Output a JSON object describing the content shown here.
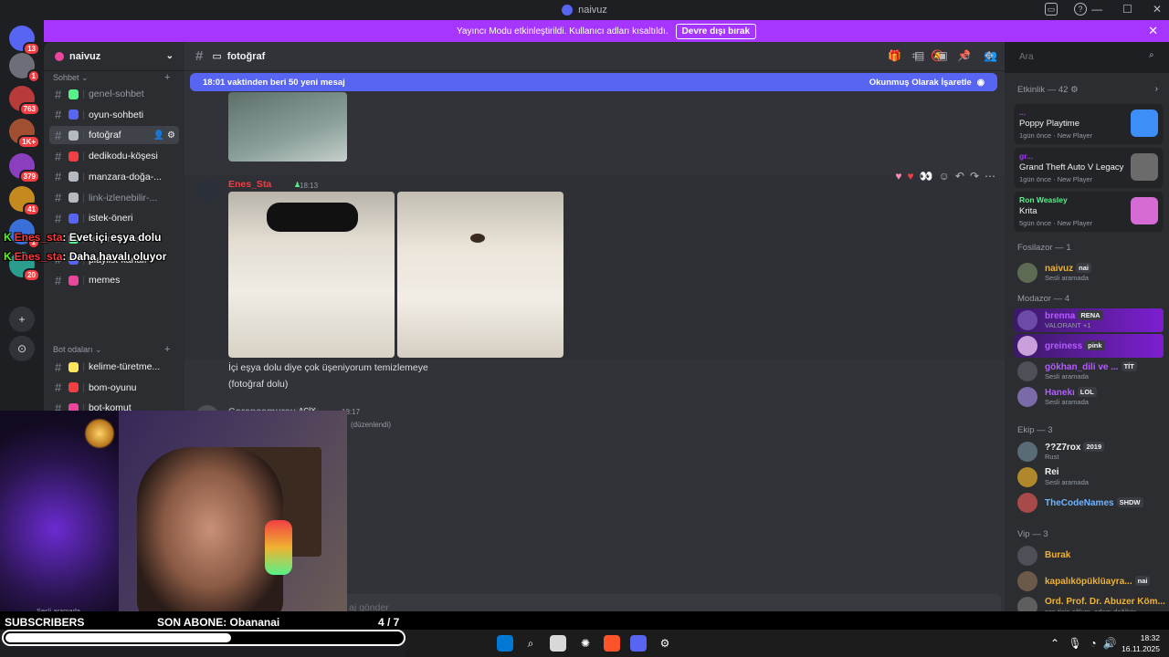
{
  "window": {
    "title": "naivuz",
    "controls": [
      "—",
      "☐",
      "✕"
    ]
  },
  "servers": [
    {
      "badge": "13",
      "color": "#5865f2"
    },
    {
      "badge": "1",
      "color": "#6d6f78"
    },
    {
      "badge": "763",
      "color": "#b83a3a"
    },
    {
      "badge": "1K+",
      "color": "#a05030"
    },
    {
      "badge": "379",
      "color": "#8a3fbf"
    },
    {
      "badge": "41",
      "color": "#c48a1f"
    },
    {
      "badge": "1",
      "color": "#3a6fd8"
    },
    {
      "badge": "20",
      "color": "#2a9d8f"
    }
  ],
  "banner": {
    "text": "Yayıncı Modu etkinleştirildi. Kullanıcı adları kısaltıldı.",
    "button": "Devre dışı bırak",
    "close": "✕"
  },
  "guild": {
    "name": "naivuz"
  },
  "categories": {
    "sohbet": "Sohbet",
    "bot": "Bot odaları"
  },
  "channels": [
    {
      "name": "genel-sohbet",
      "color": "#57f287",
      "state": ""
    },
    {
      "name": "oyun-sohbeti",
      "color": "#5865f2",
      "state": "unread"
    },
    {
      "name": "fotoğraf",
      "color": "#b5bac1",
      "state": "active"
    },
    {
      "name": "dedikodu-köşesi",
      "color": "#f23f43",
      "state": "unread",
      "prefix": "⁉"
    },
    {
      "name": "manzara-doğa-...",
      "color": "#b5bac1",
      "state": "unread"
    },
    {
      "name": "link-izlenebilir-...",
      "color": "#b5bac1",
      "state": ""
    },
    {
      "name": "istek-öneri",
      "color": "#5865f2",
      "state": "unread"
    },
    {
      "name": "resim-ve-tasarım",
      "color": "#57f287",
      "state": ""
    },
    {
      "name": "playlist-kanalı",
      "color": "#5865f2",
      "state": "unread"
    },
    {
      "name": "memes",
      "color": "#eb459e",
      "state": "unread"
    }
  ],
  "bot_channels": [
    {
      "name": "kelime-türetme...",
      "color": "#fee75c"
    },
    {
      "name": "bom-oyunu",
      "color": "#f23f43"
    },
    {
      "name": "bot-komut",
      "color": "#eb459e"
    }
  ],
  "chat": {
    "channel": "fotoğraf",
    "new_messages": "18:01 vaktinden beri 50 yeni mesaj",
    "mark_read": "Okunmuş Olarak İşaretle",
    "composer_placeholder": "aj gönder"
  },
  "messages": [
    {
      "author": "Enes_Sta",
      "time": "18:13",
      "author_color": "#f23f43",
      "lines": [
        "İçi eşya dolu diye çok üşeniyorum temizlemeye",
        "(fotoğraf dolu)"
      ]
    },
    {
      "author": "Corapsamurayı",
      "badge": "ACİX",
      "time": "18:17",
      "edited": "(düzenlendi)",
      "author_color": "#949ba4"
    }
  ],
  "search": {
    "placeholder": "Ara"
  },
  "activity": {
    "header": "Etkinlik — 42",
    "cards": [
      {
        "user": "...",
        "game": "Poppy Playtime",
        "meta": "1gün önce · New Player",
        "user_color": "#a535ff",
        "art": "#3e8ef7"
      },
      {
        "user": "gr...",
        "game": "Grand Theft Auto V Legacy",
        "meta": "1gün önce · New Player",
        "user_color": "#a535ff",
        "art": "#6b6b6b"
      },
      {
        "user": "Ron Weasley",
        "game": "Krita",
        "meta": "5gün önce · New Player",
        "user_color": "#57f287",
        "art": "#d66bd6"
      }
    ]
  },
  "member_groups": [
    {
      "title": "Fosilazor — 1",
      "members": [
        {
          "name": "naivuz",
          "tag": "nai",
          "status": "Sesli aramada",
          "color": "#f0b232"
        }
      ]
    },
    {
      "title": "Modazor — 4",
      "members": [
        {
          "name": "brenna",
          "tag": "RENA",
          "status": "VALORANT +1",
          "color": "#b45cff",
          "boost": true
        },
        {
          "name": "greiness",
          "tag": "pink",
          "status": "",
          "color": "#b45cff",
          "boost": true
        },
        {
          "name": "gökhan_dili ve ...",
          "tag": "TİT",
          "status": "Sesli aramada",
          "color": "#b45cff",
          "boost": false
        },
        {
          "name": "Hanekı",
          "tag": "LOL",
          "status": "Sesli aramada",
          "color": "#b45cff",
          "boost": false
        }
      ]
    },
    {
      "title": "Ekip — 3",
      "members": [
        {
          "name": "??Z7rox",
          "tag": "2019",
          "status": "Rust",
          "color": "#f2f3f5"
        },
        {
          "name": "Rei",
          "tag": "",
          "status": "Sesli aramada",
          "color": "#f2f3f5"
        },
        {
          "name": "TheCodeNames",
          "tag": "SHDW",
          "status": "",
          "color": "#6fb4ff"
        }
      ]
    },
    {
      "title": "Vip — 3",
      "members": [
        {
          "name": "Burak",
          "tag": "",
          "status": "",
          "color": "#f0b232"
        },
        {
          "name": "kapalıköpüklüayra...",
          "tag": "nai",
          "status": "",
          "color": "#f0b232"
        },
        {
          "name": "Ord. Prof. Dr. Abuzer Köm...",
          "tag": "",
          "status": "sen tisin oğlum, adam değilsin",
          "color": "#f0b232"
        }
      ]
    }
  ],
  "stream_overlay": {
    "chat": [
      {
        "user": "Enes_sta",
        "text": ": Evet içi eşya dolu"
      },
      {
        "user": "Enes_sta",
        "text": ": Daha havalı oluyor"
      }
    ],
    "voice_status": "Sesli aramada",
    "subscribers_label": "SUBSCRIBERS",
    "last_sub": "SON ABONE: Obananai",
    "goal": "4  / 7",
    "goal_progress": 0.57
  },
  "taskbar": {
    "time": "18:32",
    "date": "16.11.2025"
  }
}
